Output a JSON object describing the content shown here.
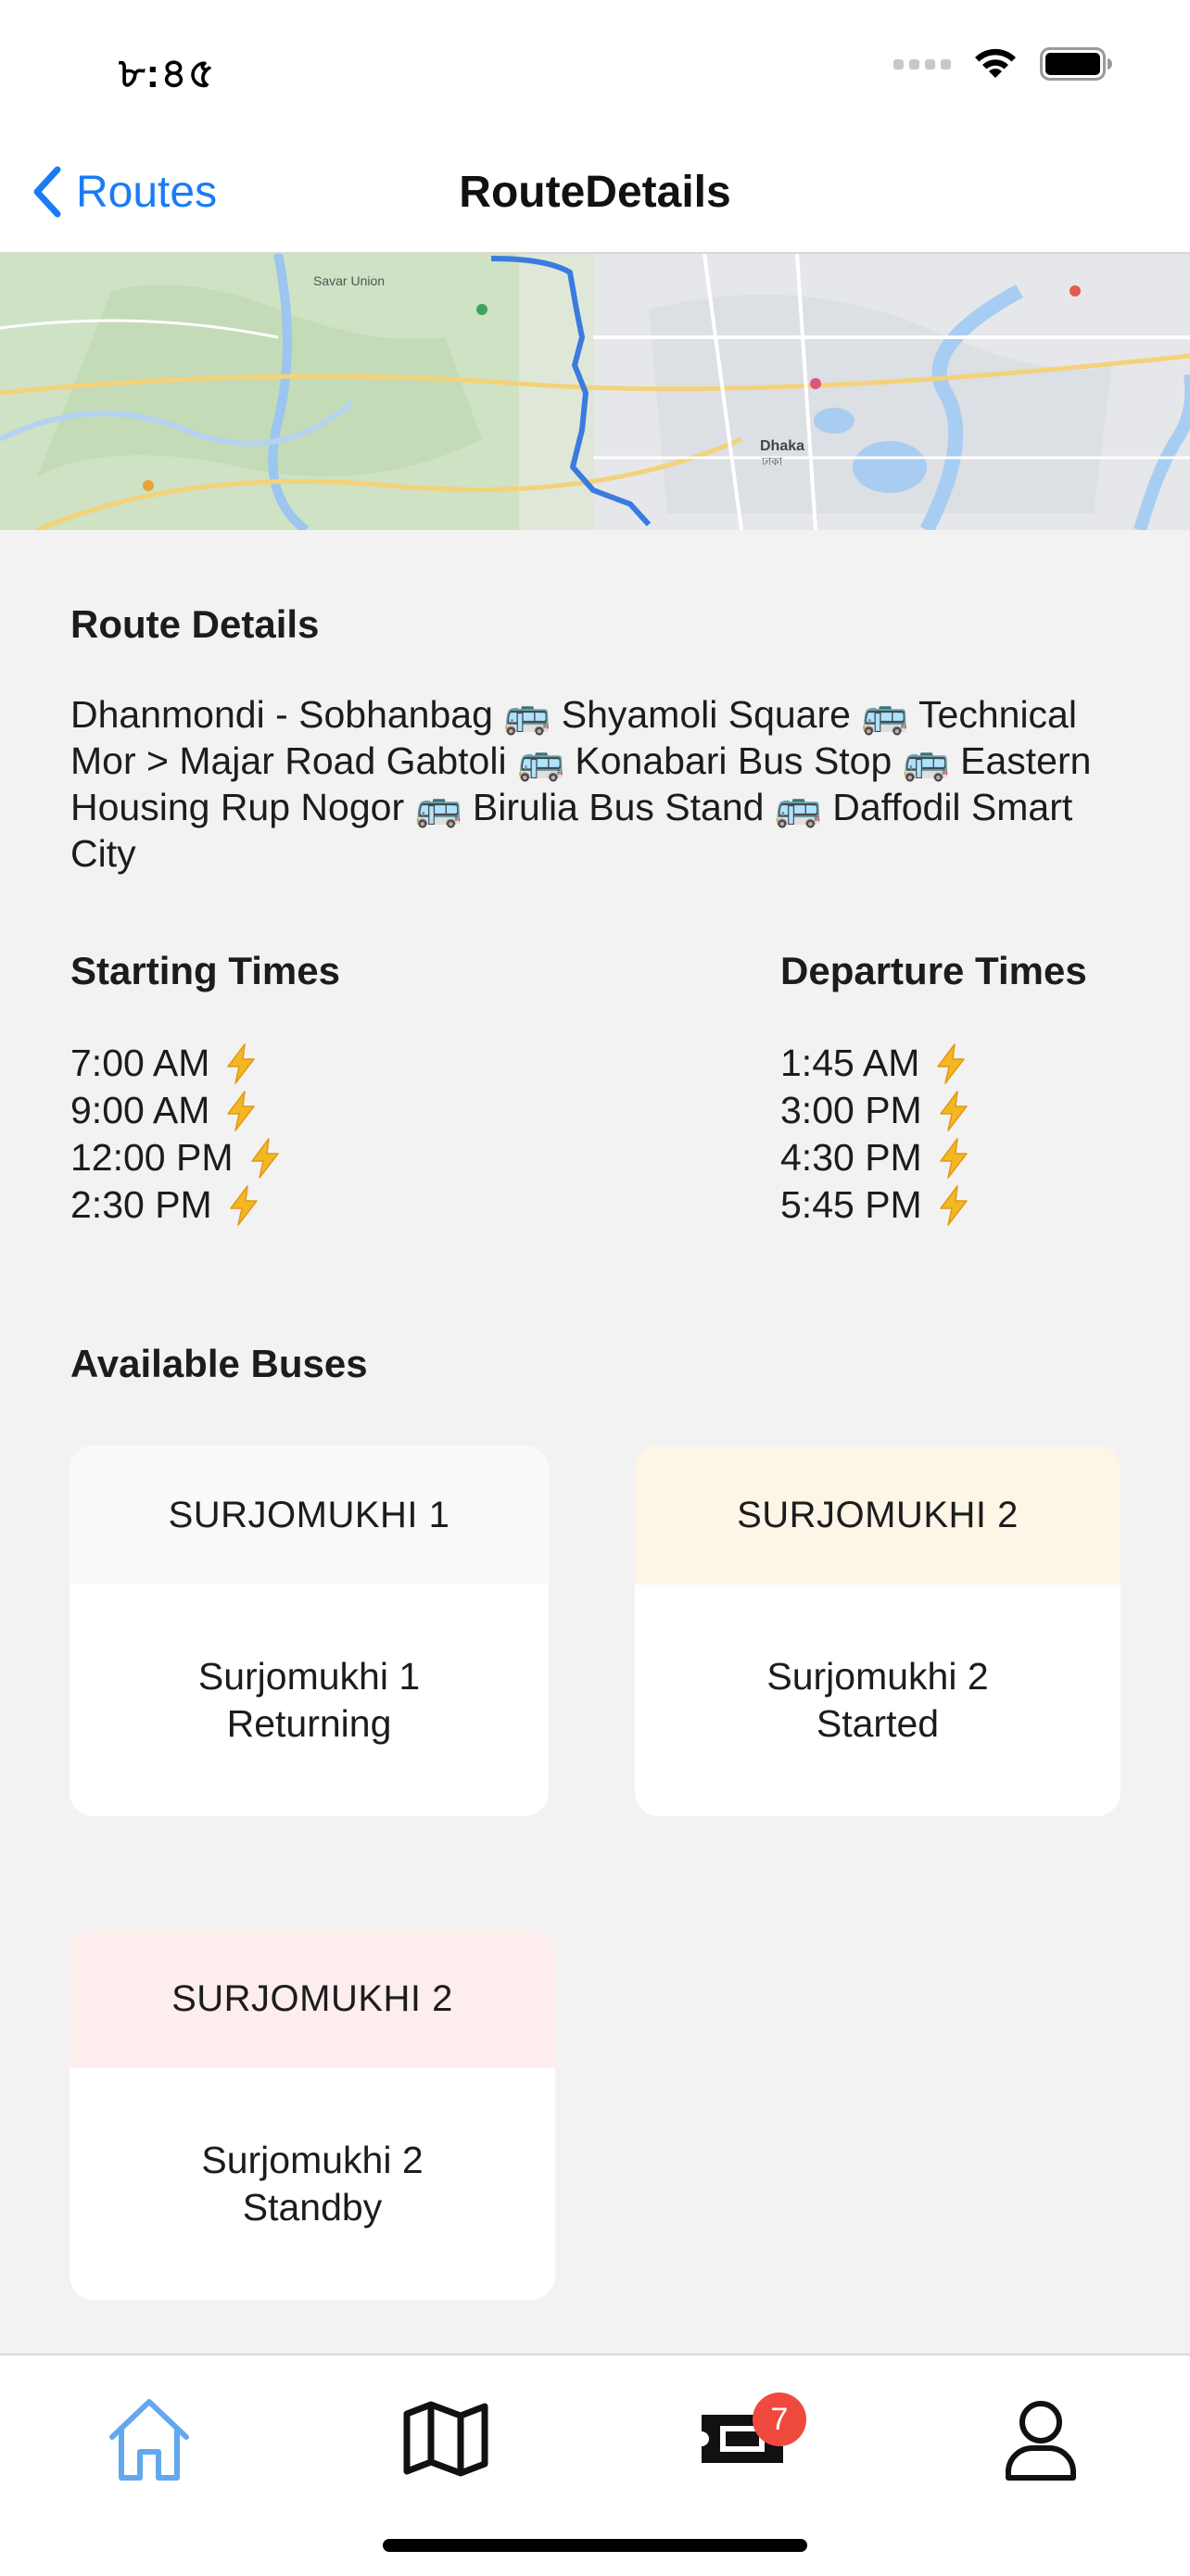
{
  "status_bar": {
    "time": "৮:৪৫",
    "icons": [
      "cellular-signal-icon",
      "wifi-icon",
      "battery-icon"
    ]
  },
  "nav": {
    "back_label": "Routes",
    "title": "RouteDetails"
  },
  "map": {
    "labels": [
      "Savar Union",
      "Dhaka",
      "ঢাকা"
    ]
  },
  "route_details": {
    "heading": "Route Details",
    "description": "Dhanmondi - Sobhanbag 🚌 Shyamoli Square 🚌 Technical Mor > Majar Road Gabtoli 🚌 Konabari Bus Stop 🚌 Eastern Housing Rup Nogor 🚌 Birulia Bus Stand 🚌 Daffodil Smart City"
  },
  "starting_times": {
    "heading": "Starting Times",
    "items": [
      "7:00 AM",
      "9:00 AM",
      "12:00 PM",
      "2:30 PM"
    ]
  },
  "departure_times": {
    "heading": "Departure Times",
    "items": [
      "1:45 AM",
      "3:00 PM",
      "4:30 PM",
      "5:45 PM"
    ]
  },
  "available_buses": {
    "heading": "Available Buses",
    "buses": [
      {
        "header": "SURJOMUKHI 1",
        "name": "Surjomukhi 1",
        "status": "Returning",
        "header_color": "#f9f9f9"
      },
      {
        "header": "SURJOMUKHI 2",
        "name": "Surjomukhi 2",
        "status": "Started",
        "header_color": "#fdf6e7"
      },
      {
        "header": "SURJOMUKHI 2",
        "name": "Surjomukhi 2",
        "status": "Standby",
        "header_color": "#fdeeed"
      }
    ]
  },
  "tab_bar": {
    "tabs": [
      {
        "name": "home",
        "icon": "home-icon",
        "active": true
      },
      {
        "name": "map",
        "icon": "map-icon",
        "active": false
      },
      {
        "name": "tickets",
        "icon": "ticket-icon",
        "active": false,
        "badge": "7"
      },
      {
        "name": "profile",
        "icon": "user-icon",
        "active": false
      }
    ]
  },
  "colors": {
    "accent": "#1a7cf5",
    "active_tab": "#63a8ee",
    "badge": "#f0493e",
    "bolt": "#f5b623"
  }
}
